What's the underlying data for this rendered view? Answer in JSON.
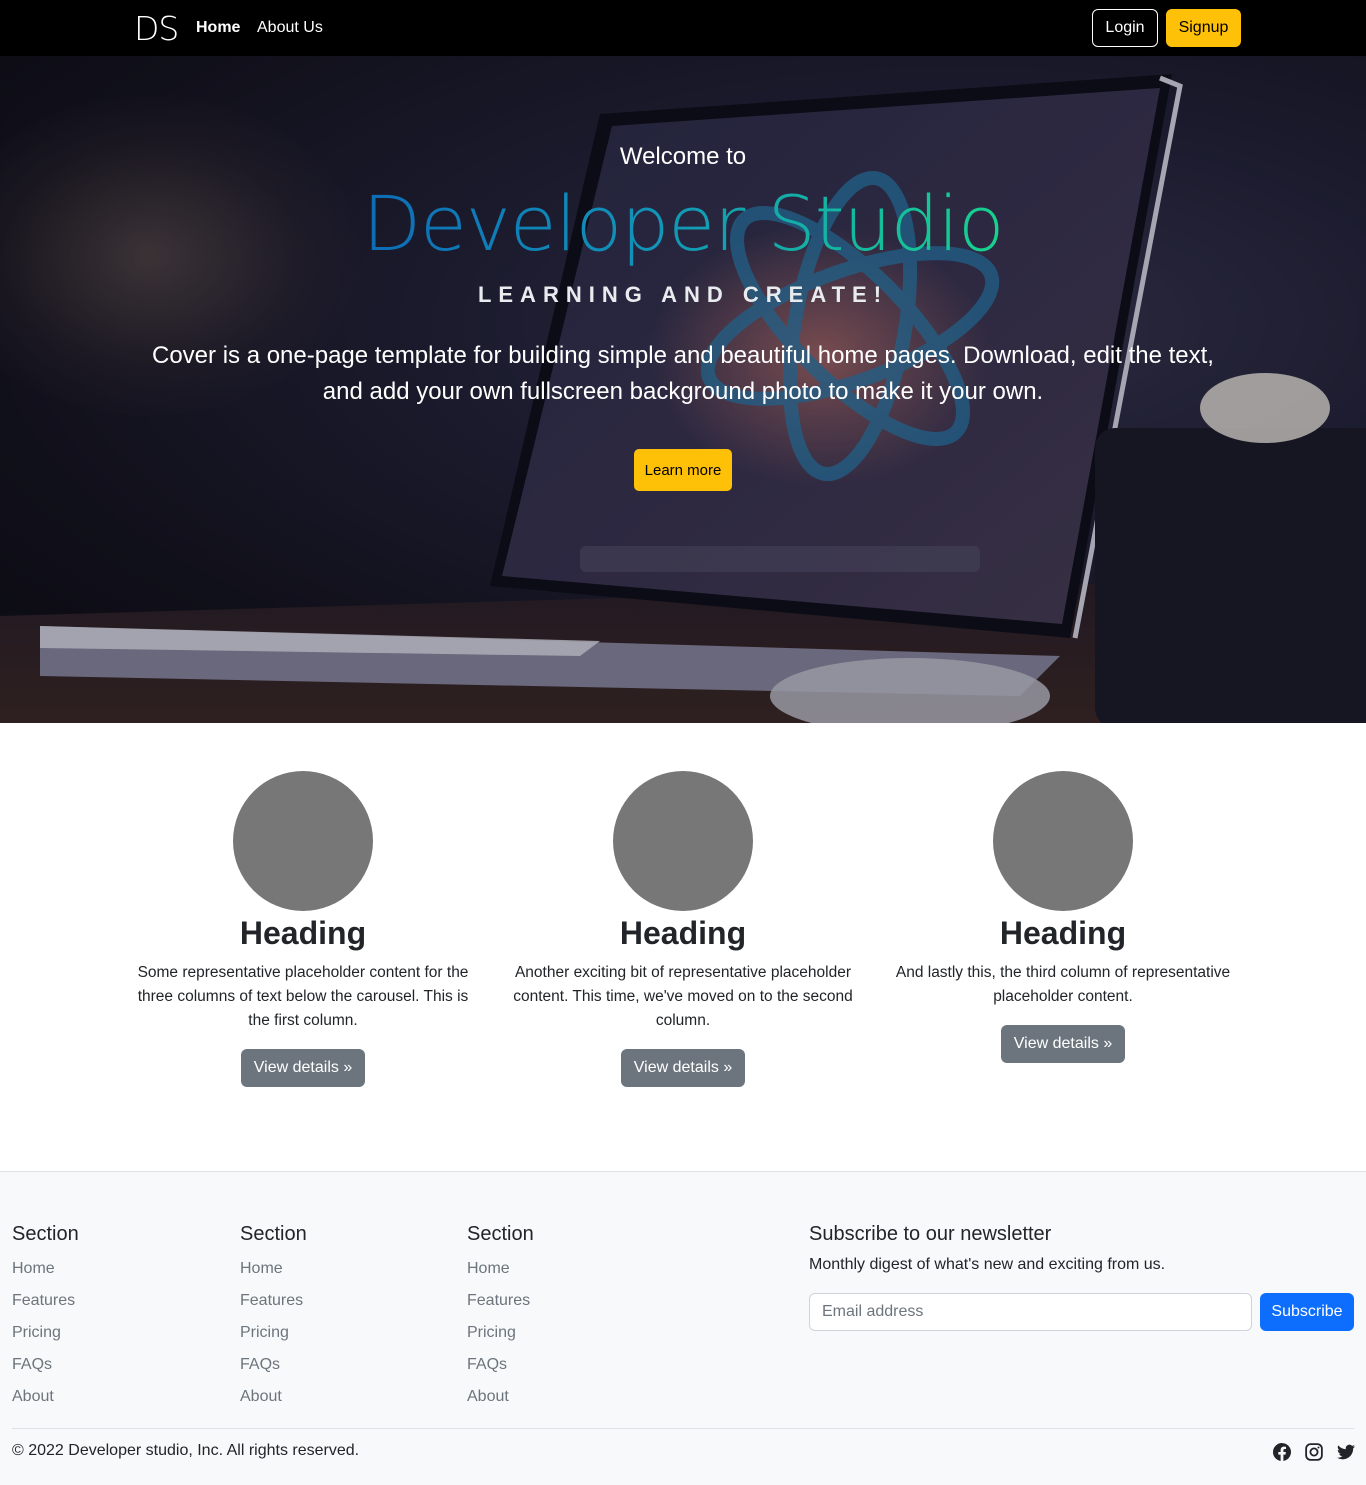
{
  "navbar": {
    "brand": "DS",
    "links": [
      "Home",
      "About Us"
    ],
    "login_label": "Login",
    "signup_label": "Signup"
  },
  "hero": {
    "welcome": "Welcome to",
    "title": "Developer Studio",
    "tagline": "LEARNING AND CREATE!",
    "lead": "Cover is a one-page template for building simple and beautiful home pages. Download, edit the text, and add your own fullscreen background photo to make it your own.",
    "cta_label": "Learn more"
  },
  "features": [
    {
      "heading": "Heading",
      "text": "Some representative placeholder content for the three columns of text below the carousel. This is the first column.",
      "button": "View details »"
    },
    {
      "heading": "Heading",
      "text": "Another exciting bit of representative placeholder content. This time, we've moved on to the second column.",
      "button": "View details »"
    },
    {
      "heading": "Heading",
      "text": "And lastly this, the third column of representative placeholder content.",
      "button": "View details »"
    }
  ],
  "footer": {
    "columns": [
      {
        "title": "Section",
        "links": [
          "Home",
          "Features",
          "Pricing",
          "FAQs",
          "About"
        ]
      },
      {
        "title": "Section",
        "links": [
          "Home",
          "Features",
          "Pricing",
          "FAQs",
          "About"
        ]
      },
      {
        "title": "Section",
        "links": [
          "Home",
          "Features",
          "Pricing",
          "FAQs",
          "About"
        ]
      }
    ],
    "newsletter": {
      "title": "Subscribe to our newsletter",
      "description": "Monthly digest of what's new and exciting from us.",
      "email_placeholder": "Email address",
      "subscribe_label": "Subscribe"
    },
    "copyright": "© 2022 Developer studio, Inc. All rights reserved.",
    "social_icons": [
      "facebook-icon",
      "instagram-icon",
      "twitter-icon"
    ]
  },
  "colors": {
    "accent_yellow": "#ffc107",
    "primary_blue": "#0d6efd",
    "secondary_gray": "#6c757d",
    "title_gradient_start": "#0e6bb5",
    "title_gradient_end": "#17d38d"
  }
}
